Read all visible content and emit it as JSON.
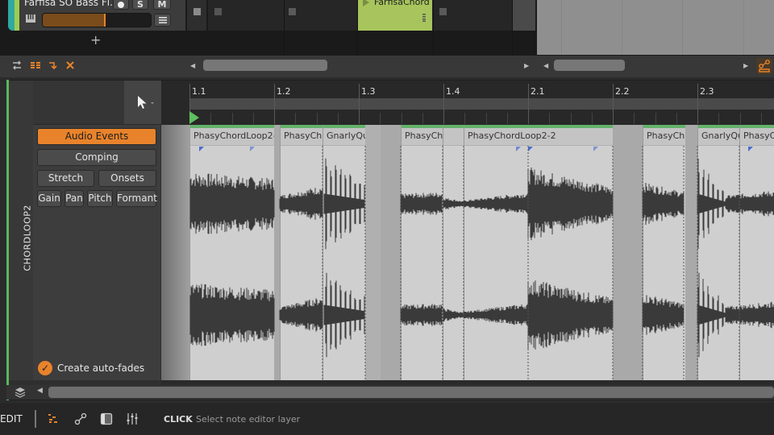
{
  "colors": {
    "accent": "#e8832b",
    "track_color": "#9ccc54",
    "track_color_2": "#2fa9a0",
    "clip_color": "#a7c55c",
    "event_header_bar": "#63b26a",
    "fade_marker": "#4a6ad0"
  },
  "launcher": {
    "track_name": "Farfisa SO Bass Fl...",
    "record_label": "",
    "solo_label": "S",
    "mute_label": "M",
    "volume_fraction": 0.58,
    "add_track_label": "+",
    "clip_name": "FarfisaChord"
  },
  "toolbar": {
    "icons": [
      "swap-icon",
      "clip-list-icon",
      "arrow-down-right-icon",
      "close-icon"
    ],
    "automation_icon": "automation-icon"
  },
  "editor": {
    "track_name": "CHORDLOOP2",
    "tool": "pointer-tool",
    "modes": {
      "audio_events": "Audio Events",
      "comping": "Comping",
      "stretch": "Stretch",
      "onsets": "Onsets",
      "gain": "Gain",
      "pan": "Pan",
      "pitch": "Pitch",
      "formant": "Formant"
    },
    "active_mode": "Audio Events",
    "auto_fades_label": "Create auto-fades",
    "auto_fades_checked": true,
    "ruler": [
      "1.1",
      "1.2",
      "1.3",
      "1.4",
      "2.1",
      "2.2",
      "2.3"
    ],
    "events": [
      {
        "name": "PhasyChordLoop2-"
      },
      {
        "name": "PhasyCh"
      },
      {
        "name": "GnarlyQu"
      },
      {
        "name": "PhasyCh"
      },
      {
        "name": "PhasyChordLoop2-2"
      },
      {
        "name": "PhasyCh"
      },
      {
        "name": "GnarlyQu"
      },
      {
        "name": "PhasyC"
      }
    ]
  },
  "statusbar": {
    "mode": "EDIT",
    "action": "CLICK",
    "hint": "Select note editor layer"
  }
}
